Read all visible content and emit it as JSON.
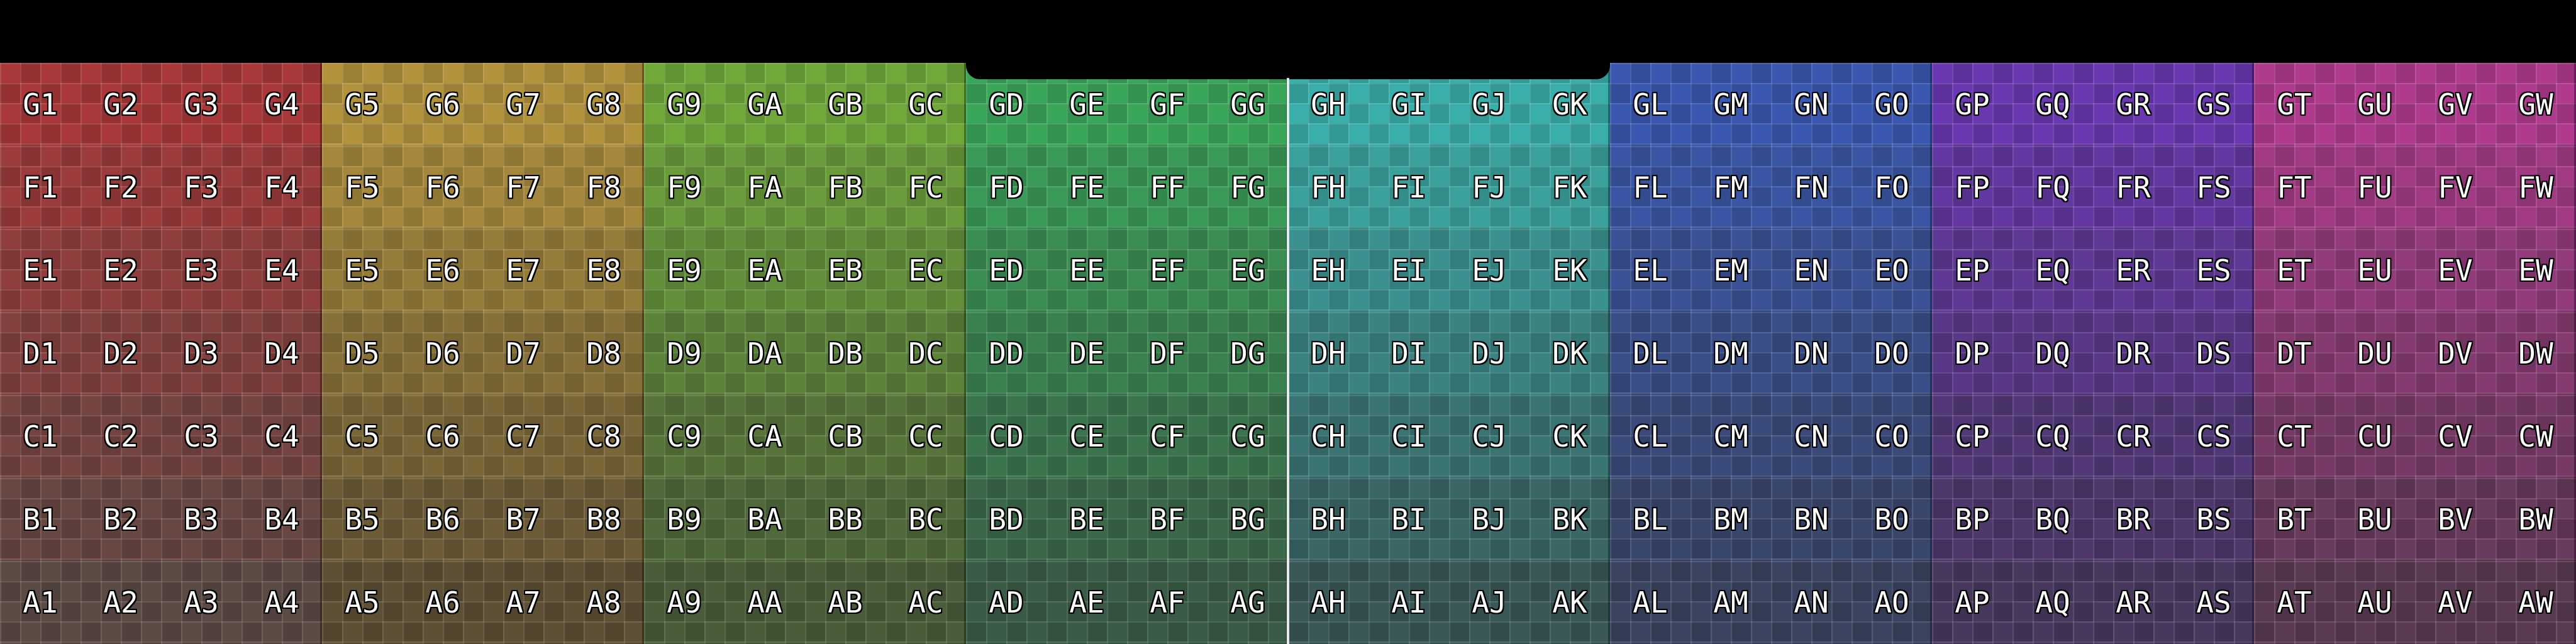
{
  "rows": [
    "G",
    "F",
    "E",
    "D",
    "C",
    "B",
    "A"
  ],
  "columns": [
    "1",
    "2",
    "3",
    "4",
    "5",
    "6",
    "7",
    "8",
    "9",
    "A",
    "B",
    "C",
    "D",
    "E",
    "F",
    "G",
    "H",
    "I",
    "J",
    "K",
    "L",
    "M",
    "N",
    "O",
    "P",
    "Q",
    "R",
    "S",
    "T",
    "U",
    "V",
    "W"
  ],
  "labels": [
    [
      "G1",
      "G2",
      "G3",
      "G4",
      "G5",
      "G6",
      "G7",
      "G8",
      "G9",
      "GA",
      "GB",
      "GC",
      "GD",
      "GE",
      "GF",
      "GG",
      "GH",
      "GI",
      "GJ",
      "GK",
      "GL",
      "GM",
      "GN",
      "GO",
      "GP",
      "GQ",
      "GR",
      "GS",
      "GT",
      "GU",
      "GV",
      "GW"
    ],
    [
      "F1",
      "F2",
      "F3",
      "F4",
      "F5",
      "F6",
      "F7",
      "F8",
      "F9",
      "FA",
      "FB",
      "FC",
      "FD",
      "FE",
      "FF",
      "FG",
      "FH",
      "FI",
      "FJ",
      "FK",
      "FL",
      "FM",
      "FN",
      "FO",
      "FP",
      "FQ",
      "FR",
      "FS",
      "FT",
      "FU",
      "FV",
      "FW"
    ],
    [
      "E1",
      "E2",
      "E3",
      "E4",
      "E5",
      "E6",
      "E7",
      "E8",
      "E9",
      "EA",
      "EB",
      "EC",
      "ED",
      "EE",
      "EF",
      "EG",
      "EH",
      "EI",
      "EJ",
      "EK",
      "EL",
      "EM",
      "EN",
      "EO",
      "EP",
      "EQ",
      "ER",
      "ES",
      "ET",
      "EU",
      "EV",
      "EW"
    ],
    [
      "D1",
      "D2",
      "D3",
      "D4",
      "D5",
      "D6",
      "D7",
      "D8",
      "D9",
      "DA",
      "DB",
      "DC",
      "DD",
      "DE",
      "DF",
      "DG",
      "DH",
      "DI",
      "DJ",
      "DK",
      "DL",
      "DM",
      "DN",
      "DO",
      "DP",
      "DQ",
      "DR",
      "DS",
      "DT",
      "DU",
      "DV",
      "DW"
    ],
    [
      "C1",
      "C2",
      "C3",
      "C4",
      "C5",
      "C6",
      "C7",
      "C8",
      "C9",
      "CA",
      "CB",
      "CC",
      "CD",
      "CE",
      "CF",
      "CG",
      "CH",
      "CI",
      "CJ",
      "CK",
      "CL",
      "CM",
      "CN",
      "CO",
      "CP",
      "CQ",
      "CR",
      "CS",
      "CT",
      "CU",
      "CV",
      "CW"
    ],
    [
      "B1",
      "B2",
      "B3",
      "B4",
      "B5",
      "B6",
      "B7",
      "B8",
      "B9",
      "BA",
      "BB",
      "BC",
      "BD",
      "BE",
      "BF",
      "BG",
      "BH",
      "BI",
      "BJ",
      "BK",
      "BL",
      "BM",
      "BN",
      "BO",
      "BP",
      "BQ",
      "BR",
      "BS",
      "BT",
      "BU",
      "BV",
      "BW"
    ],
    [
      "A1",
      "A2",
      "A3",
      "A4",
      "A5",
      "A6",
      "A7",
      "A8",
      "A9",
      "AA",
      "AB",
      "AC",
      "AD",
      "AE",
      "AF",
      "AG",
      "AH",
      "AI",
      "AJ",
      "AK",
      "AL",
      "AM",
      "AN",
      "AO",
      "AP",
      "AQ",
      "AR",
      "AS",
      "AT",
      "AU",
      "AV",
      "AW"
    ]
  ],
  "group_colors": {
    "top": [
      "#a8383a",
      "#b2923c",
      "#70a83a",
      "#3aa65a",
      "#3aaeaa",
      "#3a58b0",
      "#6a38b0",
      "#b03a8e"
    ],
    "bottom": [
      "#5c4a44",
      "#5e5034",
      "#4a5c3a",
      "#3a5c46",
      "#3a5858",
      "#3a4460",
      "#48385e",
      "#5a3a52"
    ]
  }
}
